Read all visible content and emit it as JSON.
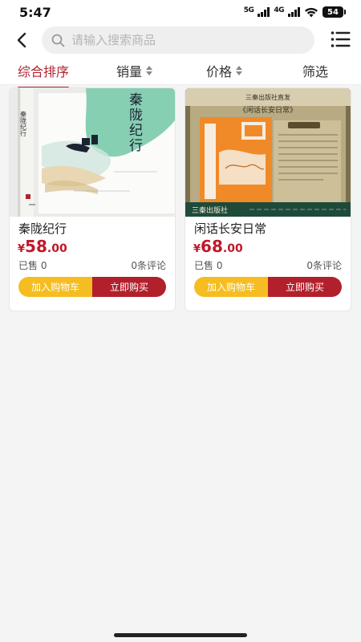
{
  "status_bar": {
    "time": "5:47",
    "network": "5G",
    "network2": "4G",
    "battery": "54"
  },
  "header": {
    "search_placeholder": "请输入搜索商品"
  },
  "tabs": [
    {
      "label": "综合排序",
      "active": true
    },
    {
      "label": "销量",
      "sortable": true
    },
    {
      "label": "价格",
      "sortable": true
    },
    {
      "label": "筛选"
    }
  ],
  "products": [
    {
      "title": "秦陇纪行",
      "currency": "¥",
      "price_int": "58",
      "price_dec": ".00",
      "sold": "已售 0",
      "reviews": "0条评论",
      "add_to_cart": "加入购物车",
      "buy_now": "立即购买",
      "cover_title": "秦陇纪行"
    },
    {
      "title": "闲话长安日常",
      "currency": "¥",
      "price_int": "68",
      "price_dec": ".00",
      "sold": "已售 0",
      "reviews": "0条评论",
      "add_to_cart": "加入购物车",
      "buy_now": "立即购买",
      "cover_banner": "三秦出版社直发",
      "cover_title": "《闲话长安日常》",
      "cover_publisher": "三秦出版社"
    }
  ],
  "colors": {
    "accent": "#b2222c",
    "cart": "#f5bd21",
    "price": "#c0182a"
  }
}
